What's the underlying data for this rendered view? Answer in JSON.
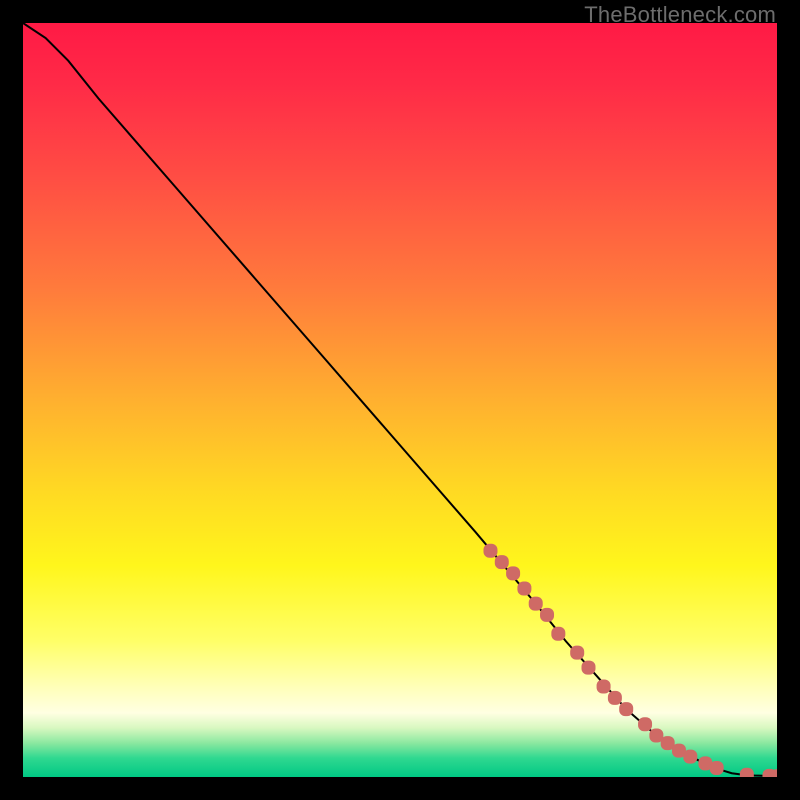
{
  "watermark": "TheBottleneck.com",
  "colors": {
    "gradient_stops": [
      {
        "offset": 0.0,
        "color": "#ff1a45"
      },
      {
        "offset": 0.08,
        "color": "#ff2a47"
      },
      {
        "offset": 0.2,
        "color": "#ff4c44"
      },
      {
        "offset": 0.35,
        "color": "#ff7a3c"
      },
      {
        "offset": 0.5,
        "color": "#ffb02f"
      },
      {
        "offset": 0.62,
        "color": "#ffd923"
      },
      {
        "offset": 0.72,
        "color": "#fff61c"
      },
      {
        "offset": 0.82,
        "color": "#ffff68"
      },
      {
        "offset": 0.88,
        "color": "#ffffb8"
      },
      {
        "offset": 0.915,
        "color": "#ffffe2"
      },
      {
        "offset": 0.935,
        "color": "#d8f8c0"
      },
      {
        "offset": 0.955,
        "color": "#8be8a0"
      },
      {
        "offset": 0.975,
        "color": "#2fd890"
      },
      {
        "offset": 1.0,
        "color": "#00c884"
      }
    ],
    "line": "#000000",
    "marker": "#cf6a65"
  },
  "chart_data": {
    "type": "line",
    "title": "",
    "xlabel": "",
    "ylabel": "",
    "xlim": [
      0,
      100
    ],
    "ylim": [
      0,
      100
    ],
    "grid": false,
    "legend": false,
    "series": [
      {
        "name": "curve",
        "x": [
          0,
          3,
          6,
          10,
          20,
          30,
          40,
          50,
          60,
          68,
          72,
          76,
          80,
          84,
          86,
          88,
          90,
          91.5,
          93,
          94,
          95.5,
          97,
          98.5,
          100
        ],
        "y": [
          100,
          98,
          95,
          90,
          78.5,
          67,
          55.5,
          44,
          32.5,
          23,
          18,
          13.5,
          9,
          5.5,
          4,
          3,
          2,
          1.3,
          0.8,
          0.5,
          0.3,
          0.2,
          0.15,
          0.1
        ]
      }
    ],
    "markers": {
      "name": "highlighted-points",
      "x": [
        62,
        63.5,
        65,
        66.5,
        68,
        69.5,
        71,
        73.5,
        75,
        77,
        78.5,
        80,
        82.5,
        84,
        85.5,
        87,
        88.5,
        90.5,
        92,
        96,
        99,
        100
      ],
      "y": [
        30,
        28.5,
        27,
        25,
        23,
        21.5,
        19,
        16.5,
        14.5,
        12,
        10.5,
        9,
        7,
        5.5,
        4.5,
        3.5,
        2.7,
        1.8,
        1.2,
        0.3,
        0.15,
        0.1
      ]
    }
  }
}
